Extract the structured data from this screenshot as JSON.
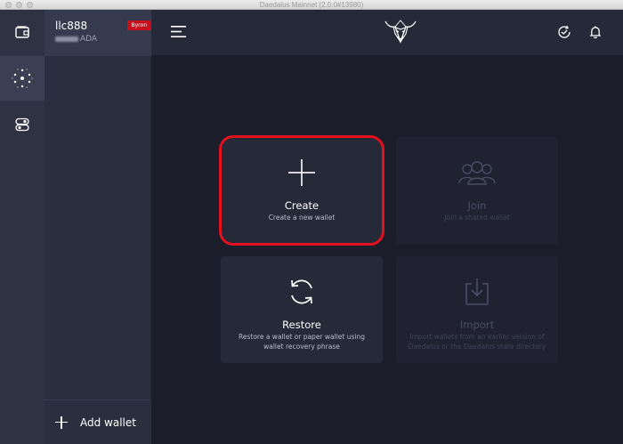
{
  "window": {
    "title": "Daedalus Mainnet (2.0.0#13980)"
  },
  "sidebar": {
    "wallet": {
      "name": "llc888",
      "balance_unit": "ADA",
      "badge": "Byron"
    },
    "add_wallet_label": "Add wallet"
  },
  "cards": {
    "create": {
      "title": "Create",
      "description": "Create a new wallet",
      "icon": "plus-icon"
    },
    "join": {
      "title": "Join",
      "description": "Join a shared wallet",
      "icon": "users-icon",
      "disabled": true
    },
    "restore": {
      "title": "Restore",
      "description": "Restore a wallet or paper wallet using wallet recovery phrase",
      "icon": "refresh-icon"
    },
    "import": {
      "title": "Import",
      "description": "Import wallets from an earlier version of Daedalus or the Daedalus state directory",
      "icon": "import-icon",
      "disabled": true
    }
  },
  "colors": {
    "background": "#1b1d2b",
    "card": "#262938",
    "highlight": "#e3101d",
    "badge": "#c8101d"
  }
}
